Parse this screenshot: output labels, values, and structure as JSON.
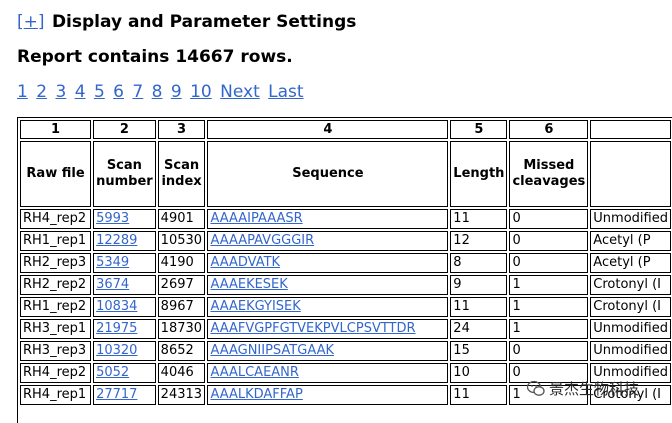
{
  "settings_toggle": {
    "symbol": "+",
    "title": "Display and Parameter Settings"
  },
  "report": {
    "summary": "Report contains 14667 rows."
  },
  "pagination": {
    "pages": [
      "1",
      "2",
      "3",
      "4",
      "5",
      "6",
      "7",
      "8",
      "9",
      "10"
    ],
    "next": "Next",
    "last": "Last"
  },
  "table": {
    "column_numbers": [
      "1",
      "2",
      "3",
      "4",
      "5",
      "6",
      ""
    ],
    "headers": [
      "Raw file",
      "Scan number",
      "Scan index",
      "Sequence",
      "Length",
      "Missed cleavages",
      ""
    ],
    "rows": [
      {
        "raw": "RH4_rep2",
        "scan": "5993",
        "index": "4901",
        "seq": "AAAAIPAAASR",
        "len": "11",
        "missed": "0",
        "mod": "Unmodified"
      },
      {
        "raw": "RH1_rep1",
        "scan": "12289",
        "index": "10530",
        "seq": "AAAAPAVGGGIR",
        "len": "12",
        "missed": "0",
        "mod": "Acetyl (P"
      },
      {
        "raw": "RH2_rep3",
        "scan": "5349",
        "index": "4190",
        "seq": "AAADVATK",
        "len": "8",
        "missed": "0",
        "mod": "Acetyl (P"
      },
      {
        "raw": "RH2_rep2",
        "scan": "3674",
        "index": "2697",
        "seq": "AAAEKESEK",
        "len": "9",
        "missed": "1",
        "mod": "Crotonyl (I"
      },
      {
        "raw": "RH1_rep2",
        "scan": "10834",
        "index": "8967",
        "seq": "AAAEKGYISEK",
        "len": "11",
        "missed": "1",
        "mod": "Crotonyl (I"
      },
      {
        "raw": "RH3_rep1",
        "scan": "21975",
        "index": "18730",
        "seq": "AAAFVGPFGTVEKPVLCPSVTTDR",
        "len": "24",
        "missed": "1",
        "mod": "Unmodified"
      },
      {
        "raw": "RH3_rep3",
        "scan": "10320",
        "index": "8652",
        "seq": "AAAGNIIPSATGAAK",
        "len": "15",
        "missed": "0",
        "mod": "Unmodified"
      },
      {
        "raw": "RH4_rep2",
        "scan": "5052",
        "index": "4046",
        "seq": "AAALCAEANR",
        "len": "10",
        "missed": "0",
        "mod": "Unmodified"
      },
      {
        "raw": "RH4_rep1",
        "scan": "27717",
        "index": "24313",
        "seq": "AAALKDAFFAP",
        "len": "11",
        "missed": "1",
        "mod": "Crotonyl (I"
      }
    ]
  },
  "watermark": {
    "text": "景杰生物科技",
    "icon": "wechat-icon"
  }
}
